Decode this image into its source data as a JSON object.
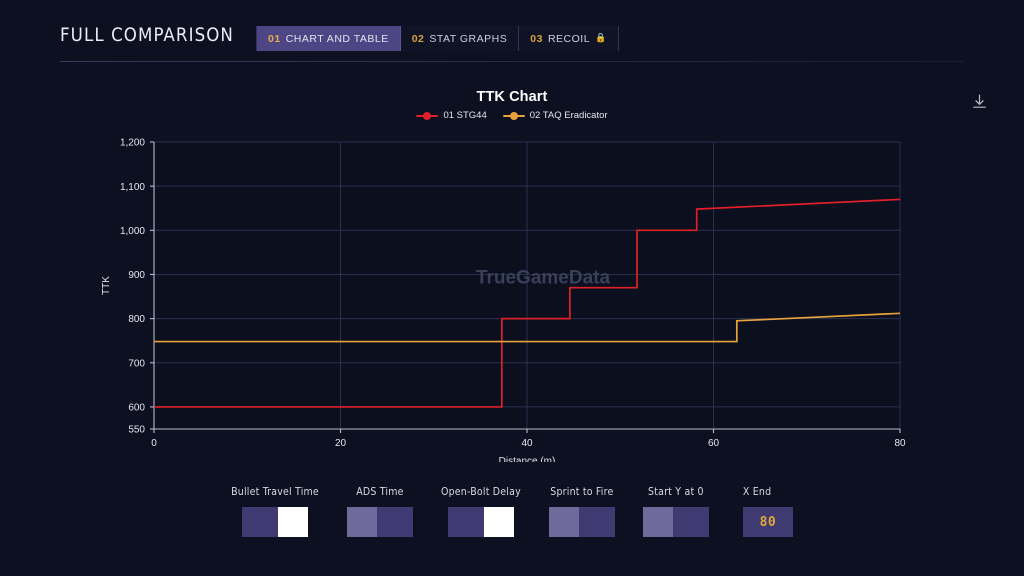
{
  "header": {
    "title": "FULL COMPARISON",
    "tabs": [
      {
        "num": "01",
        "label": "CHART AND TABLE",
        "active": true,
        "locked": false
      },
      {
        "num": "02",
        "label": "STAT GRAPHS",
        "active": false,
        "locked": false
      },
      {
        "num": "03",
        "label": "RECOIL",
        "active": false,
        "locked": true
      }
    ],
    "lock_icon": "lock-icon"
  },
  "chart_panel": {
    "download_icon": "download-icon",
    "watermark": "TrueGameData"
  },
  "controls": [
    {
      "label": "Bullet Travel Time",
      "type": "toggle",
      "state": "on",
      "name": "bullet-travel-time"
    },
    {
      "label": "ADS Time",
      "type": "toggle",
      "state": "off",
      "name": "ads-time"
    },
    {
      "label": "Open-Bolt Delay",
      "type": "toggle",
      "state": "on",
      "name": "open-bolt-delay"
    },
    {
      "label": "Sprint to Fire",
      "type": "toggle",
      "state": "off",
      "name": "sprint-to-fire"
    },
    {
      "label": "Start Y at 0",
      "type": "toggle",
      "state": "off",
      "name": "start-y-at-0"
    },
    {
      "label": "X End",
      "type": "number",
      "value": "80",
      "name": "x-end"
    }
  ],
  "chart_data": {
    "type": "line",
    "title": "TTK Chart",
    "xlabel": "Distance (m)",
    "ylabel": "TTK",
    "xlim": [
      0,
      80
    ],
    "ylim": [
      550,
      1200
    ],
    "xticks": [
      0,
      20,
      40,
      60,
      80
    ],
    "yticks": [
      550,
      600,
      700,
      800,
      900,
      1000,
      1100,
      1200
    ],
    "ytick_labels": [
      "550",
      "600",
      "700",
      "800",
      "900",
      "1,000",
      "1,100",
      "1,200"
    ],
    "grid": true,
    "legend_position": "top-center",
    "colors": {
      "series_1": "#e02028",
      "series_2": "#e8a33c"
    },
    "series": [
      {
        "name": "01 STG44",
        "color": "#e02028",
        "marker": "circle",
        "points": [
          [
            0,
            600
          ],
          [
            37.3,
            600
          ],
          [
            37.3,
            800
          ],
          [
            44.6,
            800
          ],
          [
            44.6,
            870
          ],
          [
            51.8,
            870
          ],
          [
            51.8,
            1000
          ],
          [
            58.2,
            1000
          ],
          [
            58.2,
            1048
          ],
          [
            80,
            1070
          ]
        ]
      },
      {
        "name": "02 TAQ Eradicator",
        "color": "#e8a33c",
        "marker": "circle",
        "points": [
          [
            0,
            748
          ],
          [
            62.5,
            748
          ],
          [
            62.5,
            795
          ],
          [
            80,
            812
          ]
        ]
      }
    ]
  }
}
